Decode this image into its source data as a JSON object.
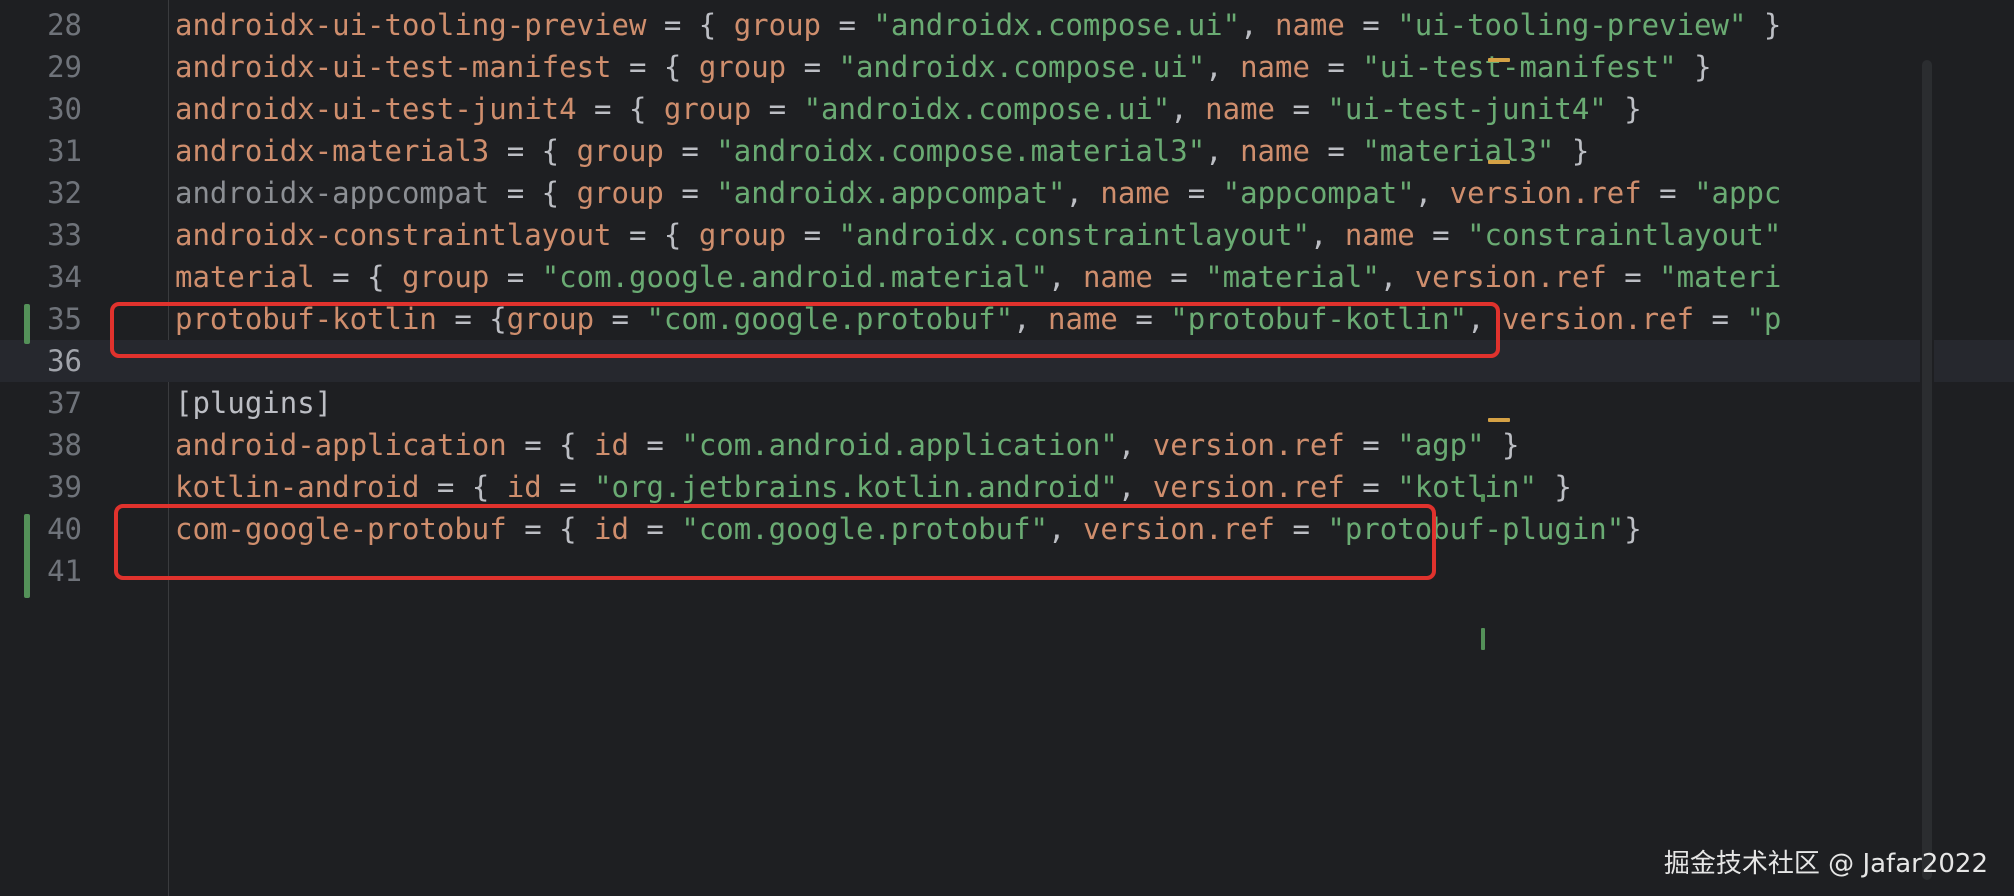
{
  "editor": {
    "lines": [
      {
        "num": "28",
        "key": "androidx-ui-tooling-preview",
        "open": " = { ",
        "k1": "group",
        "eq1": " = ",
        "v1": "\"androidx.compose.ui\"",
        "sep1": ", ",
        "k2": "name",
        "eq2": " = ",
        "v2": "\"ui-tooling-preview\"",
        "sep2": "",
        "k3": "",
        "eq3": "",
        "v3": "",
        "close": " }"
      },
      {
        "num": "29",
        "key": "androidx-ui-test-manifest",
        "open": " = { ",
        "k1": "group",
        "eq1": " = ",
        "v1": "\"androidx.compose.ui\"",
        "sep1": ", ",
        "k2": "name",
        "eq2": " = ",
        "v2": "\"ui-test-manifest\"",
        "sep2": "",
        "k3": "",
        "eq3": "",
        "v3": "",
        "close": " }"
      },
      {
        "num": "30",
        "key": "androidx-ui-test-junit4",
        "open": " = { ",
        "k1": "group",
        "eq1": " = ",
        "v1": "\"androidx.compose.ui\"",
        "sep1": ", ",
        "k2": "name",
        "eq2": " = ",
        "v2": "\"ui-test-junit4\"",
        "sep2": "",
        "k3": "",
        "eq3": "",
        "v3": "",
        "close": " }"
      },
      {
        "num": "31",
        "key": "androidx-material3",
        "open": " = { ",
        "k1": "group",
        "eq1": " = ",
        "v1": "\"androidx.compose.material3\"",
        "sep1": ", ",
        "k2": "name",
        "eq2": " = ",
        "v2": "\"material3\"",
        "sep2": "",
        "k3": "",
        "eq3": "",
        "v3": "",
        "close": " }"
      },
      {
        "num": "32",
        "key": "androidx-appcompat",
        "open": " = { ",
        "k1": "group",
        "eq1": " = ",
        "v1": "\"androidx.appcompat\"",
        "sep1": ", ",
        "k2": "name",
        "eq2": " = ",
        "v2": "\"appcompat\"",
        "sep2": ", ",
        "k3": "version.ref",
        "eq3": " = ",
        "v3": "\"appc",
        "close": ""
      },
      {
        "num": "33",
        "key": "androidx-constraintlayout",
        "open": " = { ",
        "k1": "group",
        "eq1": " = ",
        "v1": "\"androidx.constraintlayout\"",
        "sep1": ", ",
        "k2": "name",
        "eq2": " = ",
        "v2": "\"constraintlayout\"",
        "sep2": "",
        "k3": "",
        "eq3": "",
        "v3": "",
        "close": ""
      },
      {
        "num": "34",
        "key": "material",
        "open": " = { ",
        "k1": "group",
        "eq1": " = ",
        "v1": "\"com.google.android.material\"",
        "sep1": ", ",
        "k2": "name",
        "eq2": " = ",
        "v2": "\"material\"",
        "sep2": ", ",
        "k3": "version.ref",
        "eq3": " = ",
        "v3": "\"materi",
        "close": ""
      },
      {
        "num": "35",
        "key": "protobuf-kotlin",
        "open": " = {",
        "k1": "group",
        "eq1": " = ",
        "v1": "\"com.google.protobuf\"",
        "sep1": ", ",
        "k2": "name",
        "eq2": " = ",
        "v2": "\"protobuf-kotlin\"",
        "sep2": ", ",
        "k3": "version.ref",
        "eq3": " = ",
        "v3": "\"p",
        "close": ""
      },
      {
        "num": "36",
        "key": "",
        "open": "",
        "k1": "",
        "eq1": "",
        "v1": "",
        "sep1": "",
        "k2": "",
        "eq2": "",
        "v2": "",
        "sep2": "",
        "k3": "",
        "eq3": "",
        "v3": "",
        "close": ""
      },
      {
        "num": "37",
        "key": "",
        "open": "[plugins]",
        "k1": "",
        "eq1": "",
        "v1": "",
        "sep1": "",
        "k2": "",
        "eq2": "",
        "v2": "",
        "sep2": "",
        "k3": "",
        "eq3": "",
        "v3": "",
        "close": ""
      },
      {
        "num": "38",
        "key": "android-application",
        "open": " = { ",
        "k1": "id",
        "eq1": " = ",
        "v1": "\"com.android.application\"",
        "sep1": ", ",
        "k2": "version.ref",
        "eq2": " = ",
        "v2": "\"agp\"",
        "sep2": "",
        "k3": "",
        "eq3": "",
        "v3": "",
        "close": " }"
      },
      {
        "num": "39",
        "key": "kotlin-android",
        "open": " = { ",
        "k1": "id",
        "eq1": " = ",
        "v1": "\"org.jetbrains.kotlin.android\"",
        "sep1": ", ",
        "k2": "version.ref",
        "eq2": " = ",
        "v2": "\"kotlin\"",
        "sep2": "",
        "k3": "",
        "eq3": "",
        "v3": "",
        "close": " }"
      },
      {
        "num": "40",
        "key": "com-google-protobuf",
        "open": " = { ",
        "k1": "id",
        "eq1": " = ",
        "v1": "\"com.google.protobuf\"",
        "sep1": ", ",
        "k2": "version.ref",
        "eq2": " = ",
        "v2": "\"protobuf-plugin\"",
        "sep2": "",
        "k3": "",
        "eq3": "",
        "v3": "",
        "close": "}"
      },
      {
        "num": "41",
        "key": "",
        "open": "",
        "k1": "",
        "eq1": "",
        "v1": "",
        "sep1": "",
        "k2": "",
        "eq2": "",
        "v2": "",
        "sep2": "",
        "k3": "",
        "eq3": "",
        "v3": "",
        "close": ""
      }
    ]
  },
  "watermark": {
    "text": "掘金技术社区 @ Jafar2022"
  },
  "colors": {
    "background": "#1e1f22",
    "key": "#cf8e6d",
    "string": "#6aab73",
    "punctuation": "#bcbec4",
    "line_number": "#6f737a",
    "vcs_added": "#549159",
    "annotation": "#e0322d",
    "warning_mark": "#d5a145"
  }
}
